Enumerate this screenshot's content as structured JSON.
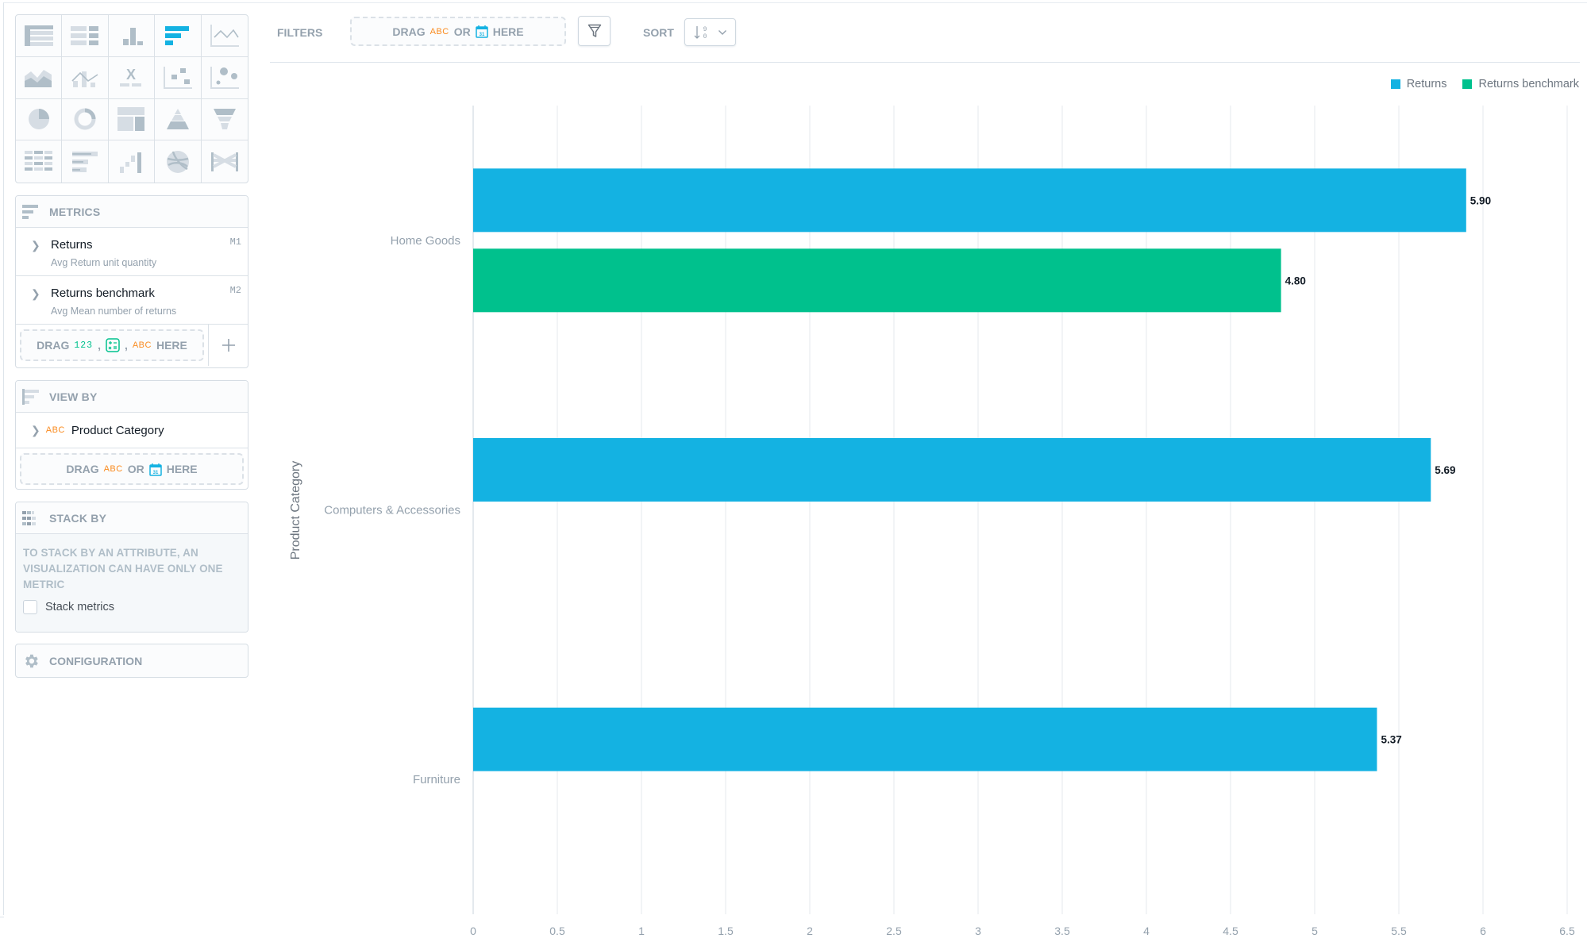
{
  "viz_types": [
    {
      "name": "table",
      "icon": "table-icon",
      "active": false
    },
    {
      "name": "headline",
      "icon": "headline-icon",
      "active": false
    },
    {
      "name": "column",
      "icon": "column-chart-icon",
      "active": false
    },
    {
      "name": "bar",
      "icon": "bar-chart-icon",
      "active": true
    },
    {
      "name": "line",
      "icon": "line-chart-icon",
      "active": false
    },
    {
      "name": "area",
      "icon": "area-chart-icon",
      "active": false
    },
    {
      "name": "combo",
      "icon": "combo-chart-icon",
      "active": false
    },
    {
      "name": "bullet",
      "icon": "bullet-chart-icon",
      "active": false
    },
    {
      "name": "scatter",
      "icon": "scatter-plot-icon",
      "active": false
    },
    {
      "name": "bubble",
      "icon": "bubble-chart-icon",
      "active": false
    },
    {
      "name": "pie",
      "icon": "pie-chart-icon",
      "active": false
    },
    {
      "name": "donut",
      "icon": "donut-chart-icon",
      "active": false
    },
    {
      "name": "treemap",
      "icon": "treemap-icon",
      "active": false
    },
    {
      "name": "pyramid",
      "icon": "pyramid-chart-icon",
      "active": false
    },
    {
      "name": "funnel",
      "icon": "funnel-chart-icon",
      "active": false
    },
    {
      "name": "heatmap",
      "icon": "heatmap-icon",
      "active": false
    },
    {
      "name": "bullet-bar",
      "icon": "bullet-bar-icon",
      "active": false
    },
    {
      "name": "waterfall",
      "icon": "waterfall-chart-icon",
      "active": false
    },
    {
      "name": "dependency-wheel",
      "icon": "dependency-wheel-icon",
      "active": false
    },
    {
      "name": "sankey",
      "icon": "sankey-chart-icon",
      "active": false
    }
  ],
  "metrics_panel": {
    "title": "METRICS",
    "items": [
      {
        "title": "Returns",
        "subtitle": "Avg Return unit quantity",
        "id": "M1"
      },
      {
        "title": "Returns benchmark",
        "subtitle": "Avg Mean number of returns",
        "id": "M2"
      }
    ],
    "drop": {
      "drag": "DRAG",
      "num": "123",
      "comma": ",",
      "abc": "ABC",
      "here": "HERE"
    },
    "add_label": "+"
  },
  "viewby_panel": {
    "title": "VIEW BY",
    "item": {
      "type": "ABC",
      "title": "Product Category"
    },
    "drop": {
      "drag": "DRAG",
      "abc": "ABC",
      "or": "OR",
      "here": "HERE"
    }
  },
  "stackby_panel": {
    "title": "STACK BY",
    "message": "TO STACK BY AN ATTRIBUTE, AN VISUALIZATION CAN HAVE ONLY ONE METRIC",
    "checkbox_label": "Stack metrics",
    "checked": false
  },
  "config_panel": {
    "title": "CONFIGURATION"
  },
  "toolbar": {
    "filters_label": "FILTERS",
    "drop": {
      "drag": "DRAG",
      "abc": "ABC",
      "or": "OR",
      "here": "HERE"
    },
    "sort_label": "SORT"
  },
  "colors": {
    "returns": "#14b2e2",
    "benchmark": "#00c18d",
    "accent": "#14b2e2",
    "abc": "#fa8c21",
    "num": "#00c18d"
  },
  "chart_data": {
    "type": "bar",
    "orientation": "horizontal",
    "categories": [
      "Home Goods",
      "Computers & Accessories",
      "Furniture"
    ],
    "series": [
      {
        "name": "Returns",
        "color": "#14b2e2",
        "values": [
          5.9,
          5.69,
          5.37
        ],
        "labels": [
          "5.90",
          "5.69",
          "5.37"
        ]
      },
      {
        "name": "Returns benchmark",
        "color": "#00c18d",
        "values": [
          4.8,
          null,
          null
        ],
        "labels": [
          "4.80",
          "",
          ""
        ]
      }
    ],
    "xlabel": "",
    "ylabel": "Product Category",
    "xlim": [
      0,
      6.5
    ],
    "xticks": [
      "0",
      "0.5",
      "1",
      "1.5",
      "2",
      "2.5",
      "3",
      "3.5",
      "4",
      "4.5",
      "5",
      "5.5",
      "6",
      "6.5"
    ],
    "xtick_values": [
      0,
      0.5,
      1,
      1.5,
      2,
      2.5,
      3,
      3.5,
      4,
      4.5,
      5,
      5.5,
      6,
      6.5
    ],
    "grid": true,
    "legend": "top-right"
  }
}
